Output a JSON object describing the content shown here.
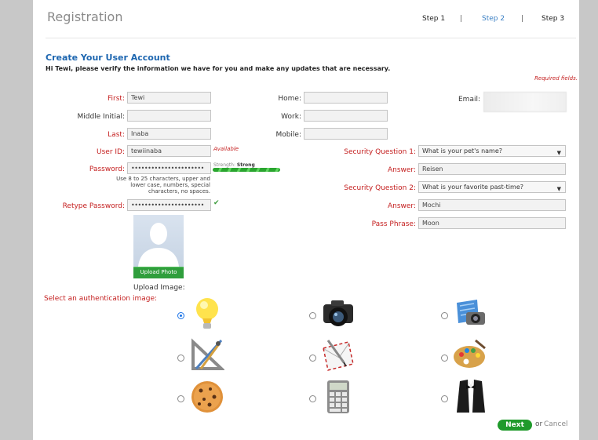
{
  "header": {
    "title": "Registration",
    "steps": [
      "Step 1",
      "Step 2",
      "Step 3"
    ],
    "separator": "|",
    "active_step": 1
  },
  "section_title": "Create Your User Account",
  "intro": "Hi Tewi, please verify the information we have for you and make any updates that are necessary.",
  "required_note": "Required fields.",
  "fields": {
    "first": {
      "label": "First:",
      "value": "Tewi"
    },
    "middle": {
      "label": "Middle Initial:",
      "value": ""
    },
    "last": {
      "label": "Last:",
      "value": "Inaba"
    },
    "userid": {
      "label": "User ID:",
      "value": "tewiinaba",
      "status": "Available"
    },
    "password": {
      "label": "Password:",
      "value": "••••••••••••••••••••••"
    },
    "strength_label": "Strength:",
    "strength_value": "Strong",
    "password_hint": [
      "Use 8 to 25 characters, upper and",
      "lower case, numbers, special",
      "characters, no spaces."
    ],
    "retype": {
      "label": "Retype Password:",
      "value": "••••••••••••••••••••••"
    },
    "retype_check": "✔",
    "home": {
      "label": "Home:",
      "value": ""
    },
    "work": {
      "label": "Work:",
      "value": ""
    },
    "mobile": {
      "label": "Mobile:",
      "value": ""
    },
    "email": {
      "label": "Email:"
    },
    "sq1": {
      "label": "Security Question 1:",
      "value": "What is your pet's name?"
    },
    "answer1": {
      "label": "Answer:",
      "value": "Reisen"
    },
    "sq2": {
      "label": "Security Question 2:",
      "value": "What is your favorite past-time?"
    },
    "answer2": {
      "label": "Answer:",
      "value": "Mochi"
    },
    "passphrase": {
      "label": "Pass Phrase:",
      "value": "Moon"
    }
  },
  "photo": {
    "upload_button": "Upload Photo",
    "upload_label": "Upload Image:"
  },
  "auth": {
    "title": "Select an authentication image:",
    "options": [
      "lightbulb-icon",
      "camera-icon",
      "camera-map-icon",
      "drafting-tools-icon",
      "envelope-pen-icon",
      "paint-palette-icon",
      "cookie-icon",
      "calculator-icon",
      "tuxedo-icon"
    ],
    "selected": 0
  },
  "actions": {
    "next": "Next",
    "or": "or",
    "cancel": "Cancel"
  },
  "colors": {
    "accent": "#1d66b0",
    "required": "#c41e1e",
    "button_green": "#1f9a2b"
  }
}
